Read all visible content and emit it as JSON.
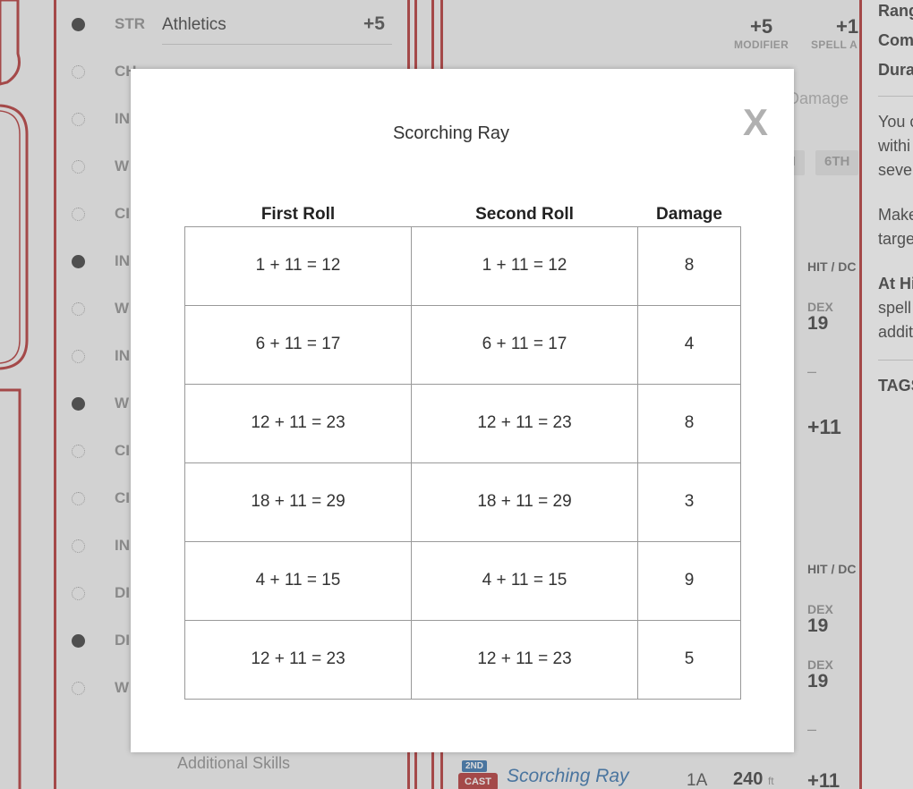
{
  "background": {
    "skills": [
      {
        "abbr": "STR",
        "name": "Athletics",
        "mod": "+5",
        "proficient": true
      },
      {
        "abbr": "CH",
        "name": "",
        "mod": "",
        "proficient": false
      },
      {
        "abbr": "IN",
        "name": "",
        "mod": "",
        "proficient": false
      },
      {
        "abbr": "W",
        "name": "",
        "mod": "",
        "proficient": false
      },
      {
        "abbr": "CI",
        "name": "",
        "mod": "",
        "proficient": false
      },
      {
        "abbr": "IN",
        "name": "",
        "mod": "",
        "proficient": true
      },
      {
        "abbr": "W",
        "name": "",
        "mod": "",
        "proficient": false
      },
      {
        "abbr": "IN",
        "name": "",
        "mod": "",
        "proficient": false
      },
      {
        "abbr": "W",
        "name": "",
        "mod": "",
        "proficient": true
      },
      {
        "abbr": "CI",
        "name": "",
        "mod": "",
        "proficient": false
      },
      {
        "abbr": "CI",
        "name": "",
        "mod": "",
        "proficient": false
      },
      {
        "abbr": "IN",
        "name": "",
        "mod": "",
        "proficient": false
      },
      {
        "abbr": "DI",
        "name": "",
        "mod": "",
        "proficient": false
      },
      {
        "abbr": "DI",
        "name": "",
        "mod": "",
        "proficient": true
      },
      {
        "abbr": "W",
        "name": "",
        "mod": "",
        "proficient": false
      }
    ],
    "additional_skills": "Additional Skills",
    "spell_stats": {
      "modifier_value": "+5",
      "modifier_label": "MODIFIER",
      "spell_attack_value": "+1",
      "spell_attack_label": "SPELL A"
    },
    "damage_search_placeholder": "Damage",
    "level_tabs": [
      "H",
      "6TH"
    ],
    "hit_dc_label": "HIT / DC",
    "saves": [
      {
        "label": "DEX",
        "value": "19"
      },
      {
        "label": "DEX",
        "value": "19"
      },
      {
        "label": "DEX",
        "value": "19"
      }
    ],
    "dash": "–",
    "attack_bonus": "+11",
    "right_panel": {
      "range": "Rang",
      "components": "Comp",
      "duration": "Durat",
      "desc_1": [
        "You c",
        "withi",
        "seve"
      ],
      "desc_2": [
        "Make",
        "targe"
      ],
      "higher_bold": "At Hi",
      "higher": [
        "spell",
        "addit"
      ],
      "tags": "TAGS"
    },
    "spell_row": {
      "level": "2ND",
      "cast": "CAST",
      "name": "Scorching Ray",
      "time": "1A",
      "range": "240",
      "range_unit": "ft",
      "hit": "+11"
    }
  },
  "modal": {
    "title": "Scorching Ray",
    "close_label": "X",
    "headers": [
      "First Roll",
      "Second Roll",
      "Damage"
    ],
    "rows": [
      [
        "1 + 11 = 12",
        "1 + 11 = 12",
        "8"
      ],
      [
        "6 + 11 = 17",
        "6 + 11 = 17",
        "4"
      ],
      [
        "12 + 11 = 23",
        "12 + 11 = 23",
        "8"
      ],
      [
        "18 + 11 = 29",
        "18 + 11 = 29",
        "3"
      ],
      [
        "4 + 11 = 15",
        "4 + 11 = 15",
        "9"
      ],
      [
        "12 + 11 = 23",
        "12 + 11 = 23",
        "5"
      ]
    ]
  },
  "colors": {
    "accent_red": "#b02a2a",
    "spell_blue": "#2b6aa8"
  }
}
